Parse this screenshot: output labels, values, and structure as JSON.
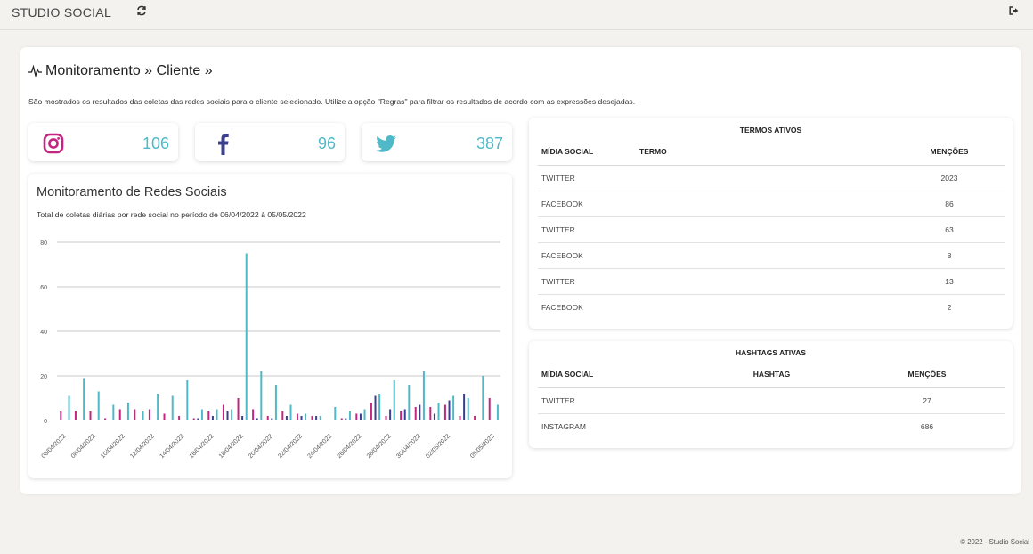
{
  "app": {
    "brand": "STUDIO SOCIAL"
  },
  "page": {
    "title": "Monitoramento » Cliente »",
    "description": "São mostrados os resultados das coletas das redes sociais para o cliente selecionado. Utilize a opção \"Regras\" para filtrar os resultados de acordo com as expressões desejadas."
  },
  "stats": {
    "instagram": "106",
    "facebook": "96",
    "twitter": "387"
  },
  "colors": {
    "instagram": "#c2267e",
    "facebook": "#3b3f8f",
    "twitter": "#4fb9c7",
    "accent": "#4fb9c7"
  },
  "chart": {
    "title": "Monitoramento de Redes Sociais",
    "subtitle": "Total de coletas diárias por rede social no período de 06/04/2022 à 05/05/2022"
  },
  "chart_data": {
    "type": "bar",
    "ylim": [
      0,
      80
    ],
    "yticks": [
      0,
      20,
      40,
      60,
      80
    ],
    "grid": true,
    "categories": [
      "06/04/2022",
      "07/04/2022",
      "08/04/2022",
      "09/04/2022",
      "10/04/2022",
      "11/04/2022",
      "12/04/2022",
      "13/04/2022",
      "14/04/2022",
      "15/04/2022",
      "16/04/2022",
      "17/04/2022",
      "18/04/2022",
      "19/04/2022",
      "20/04/2022",
      "21/04/2022",
      "22/04/2022",
      "23/04/2022",
      "24/04/2022",
      "25/04/2022",
      "26/04/2022",
      "27/04/2022",
      "28/04/2022",
      "29/04/2022",
      "30/04/2022",
      "01/05/2022",
      "02/05/2022",
      "03/05/2022",
      "04/05/2022",
      "05/05/2022"
    ],
    "xtick_labels": [
      "06/04/2022",
      "",
      "08/04/2022",
      "",
      "10/04/2022",
      "",
      "12/04/2022",
      "",
      "14/04/2022",
      "",
      "16/04/2022",
      "",
      "18/04/2022",
      "",
      "20/04/2022",
      "",
      "22/04/2022",
      "",
      "24/04/2022",
      "",
      "26/04/2022",
      "",
      "28/04/2022",
      "",
      "30/04/2022",
      "",
      "02/05/2022",
      "",
      "",
      "05/05/2022"
    ],
    "series": [
      {
        "color": "#c2267e",
        "values": [
          4,
          4,
          4,
          1,
          5,
          5,
          5,
          3,
          2,
          1,
          4,
          7,
          10,
          5,
          2,
          4,
          3,
          2,
          0,
          1,
          3,
          8,
          2,
          4,
          6,
          6,
          7,
          2,
          2,
          10
        ]
      },
      {
        "color": "#3b3f8f",
        "values": [
          0,
          0,
          0,
          0,
          0,
          0,
          0,
          0,
          0,
          1,
          2,
          4,
          2,
          1,
          1,
          2,
          2,
          2,
          0,
          1,
          3,
          11,
          5,
          5,
          7,
          3,
          9,
          12,
          0,
          0
        ]
      },
      {
        "color": "#4fb9c7",
        "values": [
          11,
          19,
          13,
          7,
          8,
          4,
          12,
          11,
          18,
          5,
          5,
          5,
          75,
          22,
          16,
          7,
          3,
          2,
          6,
          4,
          5,
          12,
          18,
          16,
          22,
          8,
          11,
          10,
          20,
          7
        ]
      }
    ]
  },
  "termos": {
    "title": "TERMOS ATIVOS",
    "headers": [
      "MÍDIA SOCIAL",
      "TERMO",
      "MENÇÕES"
    ],
    "rows": [
      {
        "midia": "TWITTER",
        "termo": "",
        "mencoes": "2023"
      },
      {
        "midia": "FACEBOOK",
        "termo": "",
        "mencoes": "86"
      },
      {
        "midia": "TWITTER",
        "termo": "",
        "mencoes": "63"
      },
      {
        "midia": "FACEBOOK",
        "termo": "",
        "mencoes": "8"
      },
      {
        "midia": "TWITTER",
        "termo": "",
        "mencoes": "13"
      },
      {
        "midia": "FACEBOOK",
        "termo": "",
        "mencoes": "2"
      }
    ]
  },
  "hashtags": {
    "title": "HASHTAGS ATIVAS",
    "headers": [
      "MÍDIA SOCIAL",
      "HASHTAG",
      "MENÇÕES"
    ],
    "rows": [
      {
        "midia": "TWITTER",
        "hashtag": "",
        "mencoes": "27"
      },
      {
        "midia": "INSTAGRAM",
        "hashtag": "",
        "mencoes": "686"
      }
    ]
  },
  "footer": "© 2022 - Studio Social"
}
